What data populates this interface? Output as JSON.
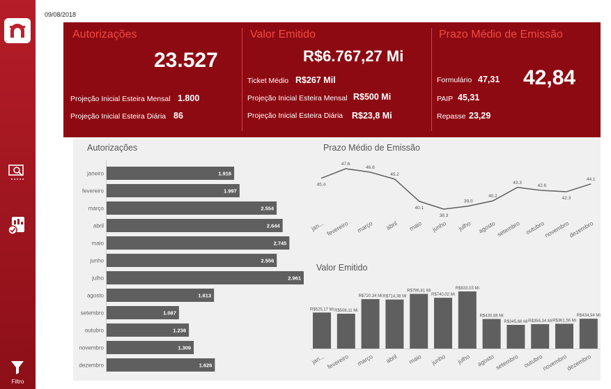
{
  "date": "09/08/2018",
  "sidebar": {
    "icons": [
      "bank-logo-icon",
      "report-search-icon",
      "checklist-icon",
      "filter-icon"
    ],
    "filter_label": "Filtro"
  },
  "kpi": {
    "autorizacoes": {
      "title": "Autorizações",
      "value": "23.527",
      "rows": [
        {
          "label": "Projeção Inicial Esteira Mensal",
          "value": "1.800"
        },
        {
          "label": "Projeção Inicial Esteira Diária",
          "value": "86"
        }
      ]
    },
    "valor_emitido": {
      "title": "Valor Emitido",
      "value": "R$6.767,27 Mi",
      "rows": [
        {
          "label": "Ticket Médio",
          "value": "R$267 Mil"
        },
        {
          "label": "Projeção Inicial Esteira Mensal",
          "value": "R$500 Mi"
        },
        {
          "label": "Projeção Inicial Esteira Diária",
          "value": "R$23,8 Mi"
        }
      ]
    },
    "prazo_medio": {
      "title": "Prazo Médio de Emissão",
      "value": "42,84",
      "rows": [
        {
          "label": "Formulário",
          "value": "47,31"
        },
        {
          "label": "PAIP",
          "value": "45,31"
        },
        {
          "label": "Repasse",
          "value": "23,29"
        }
      ]
    }
  },
  "chart_data": [
    {
      "type": "bar",
      "orientation": "horizontal",
      "title": "Autorizações",
      "categories": [
        "janeiro",
        "fevereiro",
        "março",
        "abril",
        "maio",
        "junho",
        "julho",
        "agosto",
        "setembro",
        "outubro",
        "novembro",
        "dezembro"
      ],
      "values": [
        1916,
        1997,
        2554,
        2644,
        2745,
        2556,
        2961,
        1613,
        1087,
        1236,
        1309,
        1626
      ],
      "labels": [
        "1.916",
        "1.997",
        "2.554",
        "2.644",
        "2.745",
        "2.556",
        "2.961",
        "1.613",
        "1.087",
        "1.236",
        "1.309",
        "1.626"
      ],
      "color": "#5f5f5f"
    },
    {
      "type": "line",
      "title": "Prazo Médio de Emissão",
      "categories": [
        "jan...",
        "fevereiro",
        "março",
        "abril",
        "maio",
        "junho",
        "julho",
        "agosto",
        "setembro",
        "outubro",
        "novembro",
        "dezembro"
      ],
      "values": [
        45.4,
        47.6,
        46.8,
        45.2,
        40.1,
        38.3,
        39.0,
        40.2,
        43.3,
        42.6,
        42.3,
        44.1
      ],
      "labels": [
        "45.4",
        "47.6",
        "46.8",
        "45.2",
        "40.1",
        "38.3",
        "39.0",
        "40.2",
        "43.3",
        "42.6",
        "42.3",
        "44.1"
      ],
      "color": "#5f5f5f"
    },
    {
      "type": "bar",
      "title": "Valor Emitido",
      "categories": [
        "jan...",
        "fevereiro",
        "março",
        "abril",
        "maio",
        "junho",
        "julho",
        "agosto",
        "setembro",
        "outubro",
        "novembro",
        "dezembro"
      ],
      "values": [
        525.17,
        508.11,
        720.34,
        714.38,
        796.81,
        740.02,
        833.03,
        430.88,
        345.68,
        356.34,
        361.56,
        434.94
      ],
      "labels": [
        "R$525,17 Mi",
        "R$508,11 Mi",
        "R$720,34 Mi",
        "R$714,38 Mi",
        "R$796,81 Mi",
        "R$740,02 Mi",
        "R$833,03 Mi",
        "R$430,88 Mi",
        "R$345,68 Mi",
        "R$356,34 Mi",
        "R$361,56 Mi",
        "R$434,94 Mi"
      ],
      "color": "#5f5f5f"
    }
  ]
}
